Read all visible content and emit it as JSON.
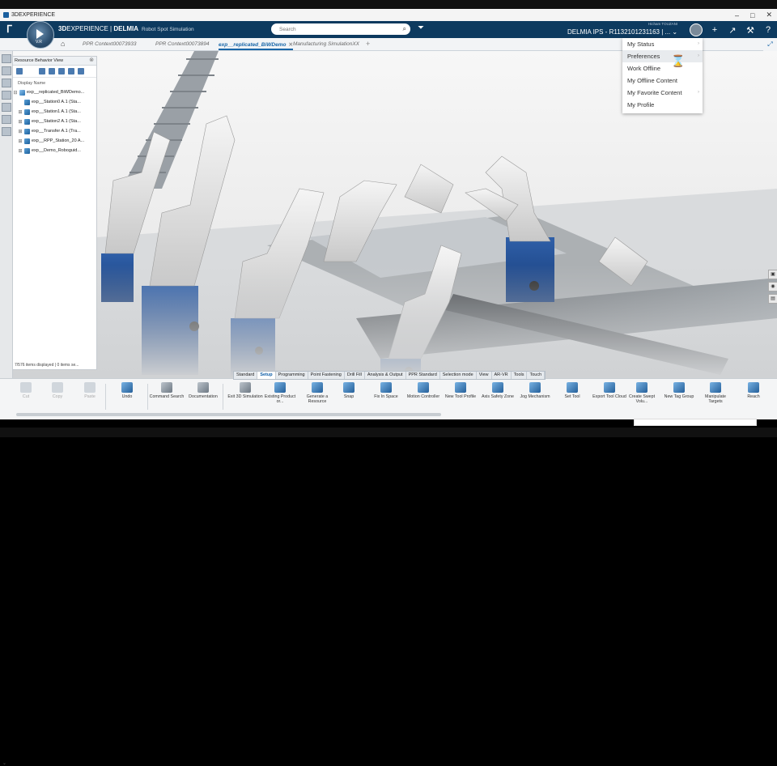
{
  "window": {
    "title": "3DEXPERIENCE",
    "controls": [
      "–",
      "□",
      "✕"
    ]
  },
  "header": {
    "brand_prefix": "3D",
    "brand_mid": "EXPERIENCE | ",
    "brand_app": "DELMIA",
    "brand_sub": "Robot Spot Simulation",
    "compass_version": "V.R",
    "search_placeholder": "Search",
    "user_name": "Hicham TOUZANI",
    "context": "DELMIA IPS - R1132101231163 | ...",
    "icons": [
      "avatar",
      "plus-icon",
      "share-icon",
      "tools-icon",
      "help-icon"
    ]
  },
  "tabs": [
    {
      "label": "PPR Context00073933",
      "active": false
    },
    {
      "label": "PPR Context00073894",
      "active": false
    },
    {
      "label": "exp__replicated_BiWDemo",
      "active": true
    },
    {
      "label": "Manufacturing SimulationXX",
      "active": false
    }
  ],
  "panel": {
    "title": "Resource Behavior View",
    "column_header": "Display Name",
    "root": "exp__replicated_BiWDemo...",
    "items": [
      "exp__Station0 A.1 (Sta...",
      "exp__Station1 A.1 (Sta...",
      "exp__Station2 A.1 (Sta...",
      "exp__Transfer A.1 (Tra...",
      "exp__RPP_Station_20 A...",
      "exp__Demo_Roboguid..."
    ],
    "status": "7/576 items displayed | 0 items se..."
  },
  "profile_menu": {
    "items": [
      {
        "label": "My Status",
        "submenu": true
      },
      {
        "label": "Preferences",
        "submenu": true
      },
      {
        "label": "Work Offline",
        "submenu": false
      },
      {
        "label": "My Offline Content",
        "submenu": false
      },
      {
        "label": "My Favorite Content",
        "submenu": true
      },
      {
        "label": "My Profile",
        "submenu": false
      }
    ],
    "highlighted": "Preferences"
  },
  "action_bar_tabs": [
    "Standard",
    "Setup",
    "Programming",
    "Point Fastening",
    "Drill Fill",
    "Analysis & Output",
    "PPR Standard",
    "Selection mode",
    "View",
    "AR-VR",
    "Tools",
    "Touch"
  ],
  "action_bar_active": "Setup",
  "toolbar": [
    {
      "label": "Cut",
      "disabled": true
    },
    {
      "label": "Copy",
      "disabled": true
    },
    {
      "label": "Paste",
      "disabled": true
    },
    {
      "label": "Undo",
      "disabled": false
    },
    {
      "label": "Command Search",
      "disabled": false
    },
    {
      "label": "Documentation",
      "disabled": false
    },
    {
      "label": "Exit 3D Simulation",
      "disabled": false
    },
    {
      "label": "Existing Product or...",
      "disabled": false
    },
    {
      "label": "Generate a Resource",
      "disabled": false
    },
    {
      "label": "Snap",
      "disabled": false
    },
    {
      "label": "Fix In Space",
      "disabled": false
    },
    {
      "label": "Motion Controller",
      "disabled": false
    },
    {
      "label": "New Tool Profile",
      "disabled": false
    },
    {
      "label": "Axis Safety Zone",
      "disabled": false
    },
    {
      "label": "Jog Mechanism",
      "disabled": false
    },
    {
      "label": "Set Tool",
      "disabled": false
    },
    {
      "label": "Export Tool Cloud",
      "disabled": false
    },
    {
      "label": "Create Swept Volu...",
      "disabled": false
    },
    {
      "label": "New Tag Group",
      "disabled": false
    },
    {
      "label": "Manipulate Targets",
      "disabled": false
    },
    {
      "label": "Reach",
      "disabled": false
    }
  ]
}
